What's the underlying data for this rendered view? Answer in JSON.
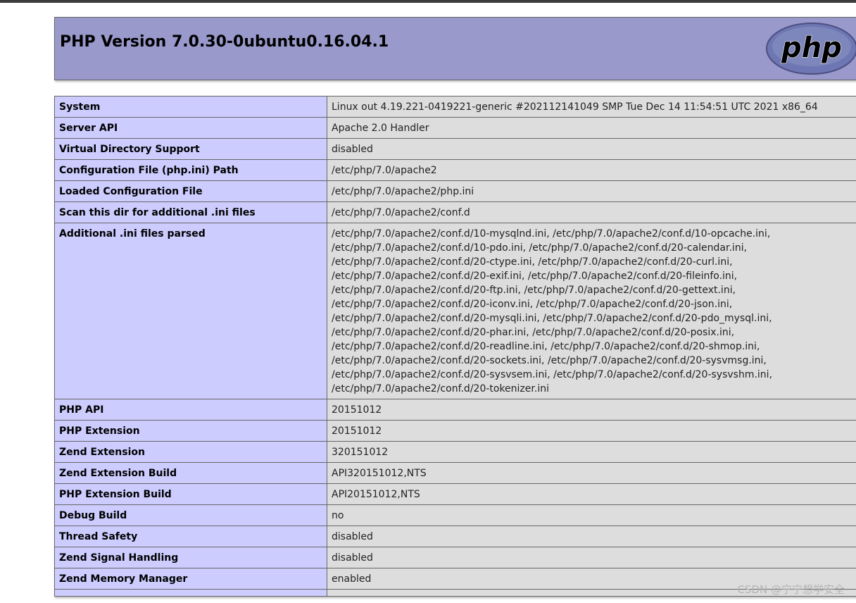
{
  "header": {
    "title": "PHP Version 7.0.30-0ubuntu0.16.04.1",
    "logo_text": "php"
  },
  "rows": [
    {
      "label": "System",
      "value": "Linux out 4.19.221-0419221-generic #202112141049 SMP Tue Dec 14 11:54:51 UTC 2021 x86_64"
    },
    {
      "label": "Server API",
      "value": "Apache 2.0 Handler"
    },
    {
      "label": "Virtual Directory Support",
      "value": "disabled"
    },
    {
      "label": "Configuration File (php.ini) Path",
      "value": "/etc/php/7.0/apache2"
    },
    {
      "label": "Loaded Configuration File",
      "value": "/etc/php/7.0/apache2/php.ini"
    },
    {
      "label": "Scan this dir for additional .ini files",
      "value": "/etc/php/7.0/apache2/conf.d"
    },
    {
      "label": "Additional .ini files parsed",
      "lines": [
        "/etc/php/7.0/apache2/conf.d/10-mysqlnd.ini, /etc/php/7.0/apache2/conf.d/10-opcache.ini,",
        "/etc/php/7.0/apache2/conf.d/10-pdo.ini, /etc/php/7.0/apache2/conf.d/20-calendar.ini,",
        "/etc/php/7.0/apache2/conf.d/20-ctype.ini, /etc/php/7.0/apache2/conf.d/20-curl.ini,",
        "/etc/php/7.0/apache2/conf.d/20-exif.ini, /etc/php/7.0/apache2/conf.d/20-fileinfo.ini,",
        "/etc/php/7.0/apache2/conf.d/20-ftp.ini, /etc/php/7.0/apache2/conf.d/20-gettext.ini,",
        "/etc/php/7.0/apache2/conf.d/20-iconv.ini, /etc/php/7.0/apache2/conf.d/20-json.ini,",
        "/etc/php/7.0/apache2/conf.d/20-mysqli.ini, /etc/php/7.0/apache2/conf.d/20-pdo_mysql.ini,",
        "/etc/php/7.0/apache2/conf.d/20-phar.ini, /etc/php/7.0/apache2/conf.d/20-posix.ini,",
        "/etc/php/7.0/apache2/conf.d/20-readline.ini, /etc/php/7.0/apache2/conf.d/20-shmop.ini,",
        "/etc/php/7.0/apache2/conf.d/20-sockets.ini, /etc/php/7.0/apache2/conf.d/20-sysvmsg.ini,",
        "/etc/php/7.0/apache2/conf.d/20-sysvsem.ini, /etc/php/7.0/apache2/conf.d/20-sysvshm.ini,",
        "/etc/php/7.0/apache2/conf.d/20-tokenizer.ini"
      ]
    },
    {
      "label": "PHP API",
      "value": "20151012"
    },
    {
      "label": "PHP Extension",
      "value": "20151012"
    },
    {
      "label": "Zend Extension",
      "value": "320151012"
    },
    {
      "label": "Zend Extension Build",
      "value": "API320151012,NTS"
    },
    {
      "label": "PHP Extension Build",
      "value": "API20151012,NTS"
    },
    {
      "label": "Debug Build",
      "value": "no"
    },
    {
      "label": "Thread Safety",
      "value": "disabled"
    },
    {
      "label": "Zend Signal Handling",
      "value": "disabled"
    },
    {
      "label": "Zend Memory Manager",
      "value": "enabled"
    },
    {
      "label": "",
      "value": ""
    }
  ],
  "watermark": "CSDN @宁宁想学安全",
  "colors": {
    "header_bg": "#9999cc",
    "label_bg": "#ccccff",
    "value_bg": "#dddddd",
    "topbar": "#3c3c3c"
  }
}
